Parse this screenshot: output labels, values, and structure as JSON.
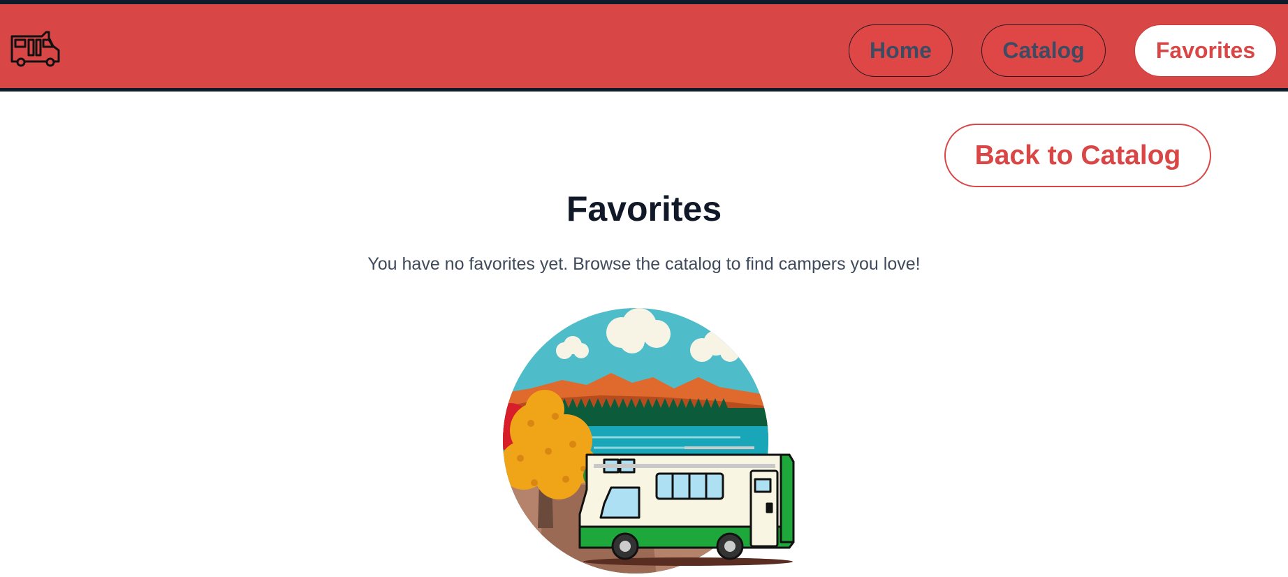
{
  "header": {
    "logo_icon": "camper-van-icon",
    "nav": {
      "home": "Home",
      "catalog": "Catalog",
      "favorites": "Favorites"
    },
    "accent_color": "#d94646"
  },
  "main": {
    "back_button": "Back to Catalog",
    "title": "Favorites",
    "empty_message": "You have no favorites yet. Browse the catalog to find campers you love!",
    "illustration_icon": "camper-landscape-illustration"
  }
}
